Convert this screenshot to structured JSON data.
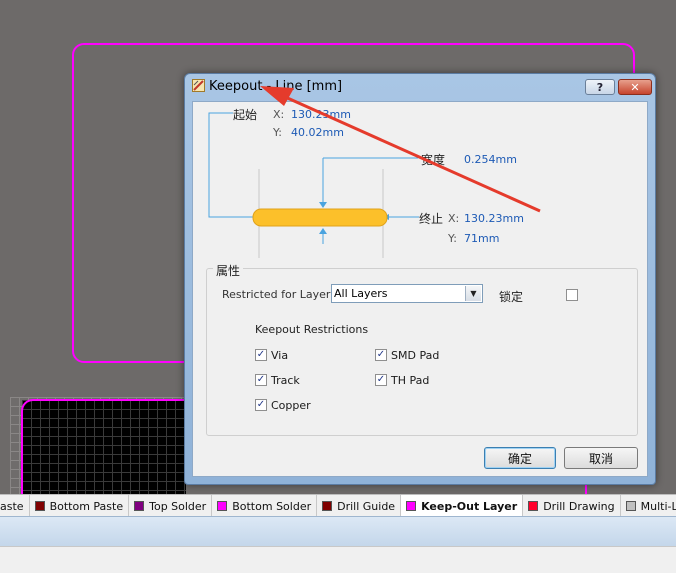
{
  "dialog": {
    "title": "Keepout - Line [mm]",
    "start": {
      "label": "起始",
      "x_label": "X:",
      "x_value": "130.23mm",
      "y_label": "Y:",
      "y_value": "40.02mm"
    },
    "width": {
      "label": "宽度",
      "value": "0.254mm"
    },
    "end": {
      "label": "终止",
      "x_label": "X:",
      "x_value": "130.23mm",
      "y_label": "Y:",
      "y_value": "71mm"
    },
    "properties": {
      "title": "属性",
      "restricted_label": "Restricted for Layer",
      "restricted_value": "All Layers",
      "lock_label": "锁定",
      "lock_checked": false,
      "restrictions_title": "Keepout Restrictions",
      "restrictions": [
        {
          "label": "Via",
          "checked": true
        },
        {
          "label": "Track",
          "checked": true
        },
        {
          "label": "Copper",
          "checked": true
        },
        {
          "label": "SMD Pad",
          "checked": true
        },
        {
          "label": "TH Pad",
          "checked": true
        }
      ]
    },
    "ok_label": "确定",
    "cancel_label": "取消",
    "help_label": "?",
    "close_label": "✕"
  },
  "layers": [
    {
      "label": "aste",
      "color": "#808080"
    },
    {
      "label": "Bottom Paste",
      "color": "#800000"
    },
    {
      "label": "Top Solder",
      "color": "#800080"
    },
    {
      "label": "Bottom Solder",
      "color": "#ff00ff"
    },
    {
      "label": "Drill Guide",
      "color": "#800000"
    },
    {
      "label": "Keep-Out Layer",
      "color": "#ff00ff",
      "active": true
    },
    {
      "label": "Drill Drawing",
      "color": "#ff002a"
    },
    {
      "label": "Multi-Layer",
      "color": "#c0c0c0"
    }
  ],
  "colors": {
    "keepout": "#ff00ff",
    "track_fill": "#fcc02a",
    "annotation_arrow": "#e53b2c",
    "dimension_line": "#4aa3df"
  }
}
